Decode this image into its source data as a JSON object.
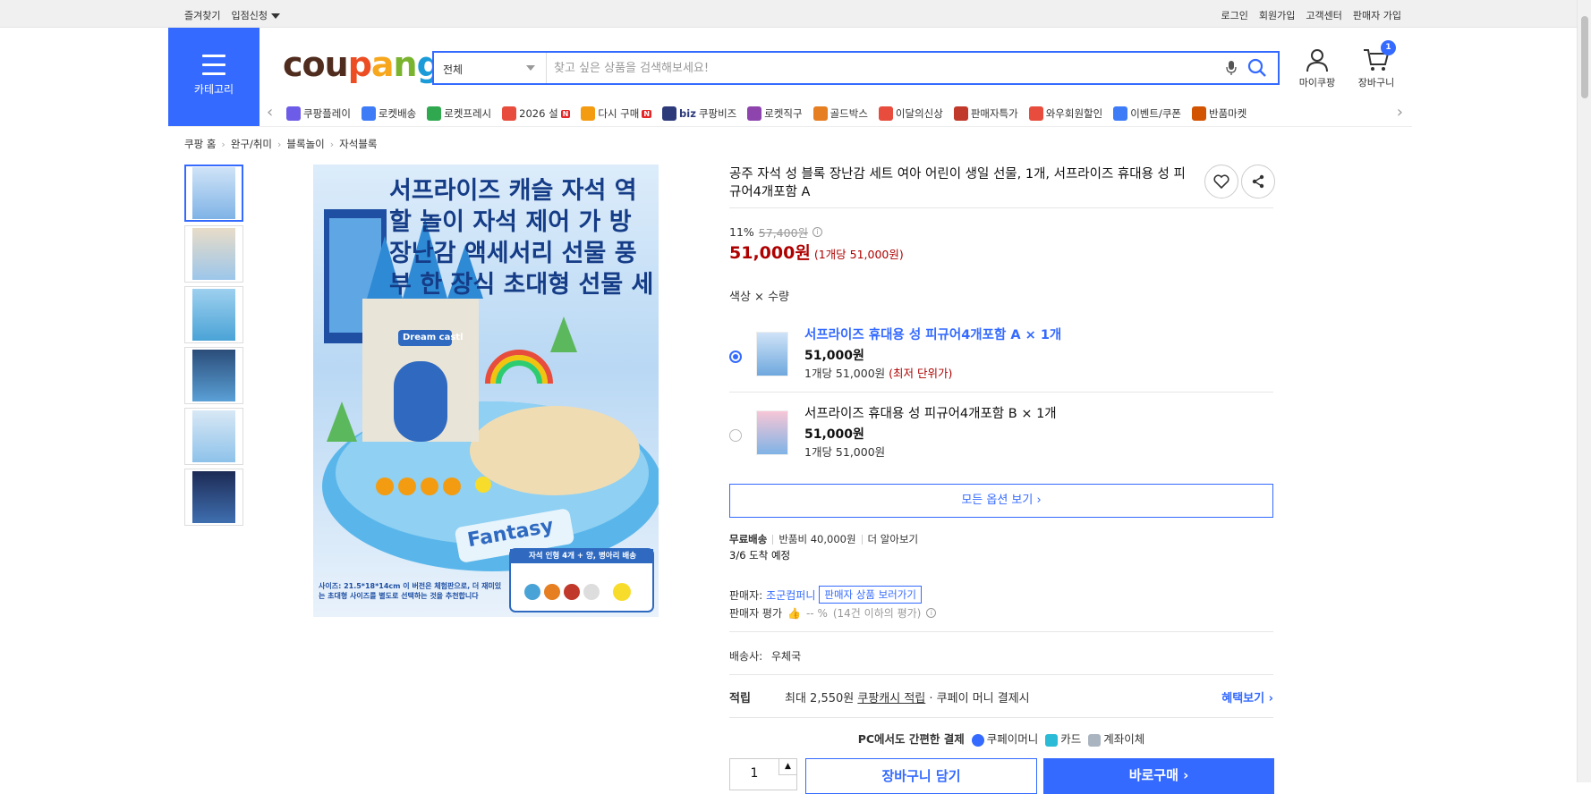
{
  "topbar": {
    "left": [
      "즐겨찾기",
      "입점신청"
    ],
    "right": [
      "로그인",
      "회원가입",
      "고객센터",
      "판매자 가입"
    ]
  },
  "category": {
    "label": "카테고리"
  },
  "logo": {
    "text": "coupang",
    "colors": [
      "#4f2c1d",
      "#ec4d23",
      "#f7a71d",
      "#7ab32e",
      "#1b9cd9"
    ]
  },
  "search": {
    "scope": "전체",
    "placeholder": "찾고 싶은 상품을 검색해보세요!"
  },
  "header": {
    "my": "마이쿠팡",
    "cart": "장바구니",
    "cart_count": "1"
  },
  "nav": {
    "items": [
      {
        "label": "쿠팡플레이",
        "color": "#6c5ce7"
      },
      {
        "label": "로켓배송",
        "color": "#3d7bf7"
      },
      {
        "label": "로켓프레시",
        "color": "#2fa84f"
      },
      {
        "label": "2026 설",
        "color": "#e74c3c"
      },
      {
        "label": "다시 구매",
        "color": "#f39c12"
      },
      {
        "label": "쿠팡비즈",
        "color": "#2d3a7a"
      },
      {
        "label": "로켓직구",
        "color": "#8e44ad"
      },
      {
        "label": "골드박스",
        "color": "#e67e22"
      },
      {
        "label": "이달의신상",
        "color": "#e74c3c"
      },
      {
        "label": "판매자특가",
        "color": "#c0392b"
      },
      {
        "label": "와우회원할인",
        "color": "#e74c3c"
      },
      {
        "label": "이벤트/쿠폰",
        "color": "#3d7bf7"
      },
      {
        "label": "반품마켓",
        "color": "#d35400"
      }
    ],
    "badge_new": "N",
    "biz_prefix": "biz"
  },
  "breadcrumb": [
    "쿠팡 홈",
    "완구/취미",
    "블록놀이",
    "자석블록"
  ],
  "product": {
    "title": "공주 자석 성 블록 장난감 세트 여아 어린이 생일 선물, 1개, 서프라이즈 휴대용 성 피규어4개포함 A",
    "image_headline": "서프라이즈 캐슬 자석 역할 놀이 자석 제어 가 방 장난감 액세서리 선물 풍부 한 장식 초대형 선물 세",
    "image_banner": "자석 인형 4개 + 양, 병아리 배송",
    "image_badge": "Dream castl",
    "image_sign": "Fantasy",
    "image_note": "사이즈: 21.5*18*14cm 이 버전은 체험판으로, 더 재미있는 초대형 사이즈를 별도로 선택하는 것을 추천합니다",
    "discount_rate": "11%",
    "original_price": "57,400원",
    "price": "51,000원",
    "unit_price": "(1개당 51,000원)",
    "option_label": "색상 × 수량",
    "options": [
      {
        "name": "서프라이즈 휴대용 성 피규어4개포함 A × 1개",
        "price": "51,000원",
        "unit": "1개당 51,000원",
        "best": "(최저 단위가)",
        "selected": true
      },
      {
        "name": "서프라이즈 휴대용 성 피규어4개포함 B × 1개",
        "price": "51,000원",
        "unit": "1개당 51,000원",
        "best": "",
        "selected": false
      }
    ],
    "all_options": "모든 옵션 보기 ›"
  },
  "shipping": {
    "free": "무료배송",
    "return_fee": "반품비 40,000원",
    "more": "더 알아보기",
    "eta": "3/6 도착 예정"
  },
  "seller": {
    "label": "판매자:",
    "name": "조군컴퍼니",
    "view_button": "판매자 상품 보러가기",
    "rating_label": "판매자 평가",
    "rating_value": "-- %",
    "rating_note": "(14건 이하의 평가)"
  },
  "carrier": {
    "label": "배송사:",
    "name": "우체국"
  },
  "points": {
    "label": "적립",
    "text_prefix": "최대 2,550원",
    "text_link": "쿠팡캐시 적립",
    "text_suffix": "· 쿠페이 머니 결제시",
    "benefit": "혜택보기 ›"
  },
  "pay": {
    "title": "PC에서도 간편한 결제",
    "methods": [
      "쿠페이머니",
      "카드",
      "계좌이체"
    ]
  },
  "buy": {
    "quantity": "1",
    "cart_button": "장바구니 담기",
    "buy_button": "바로구매 ›"
  }
}
